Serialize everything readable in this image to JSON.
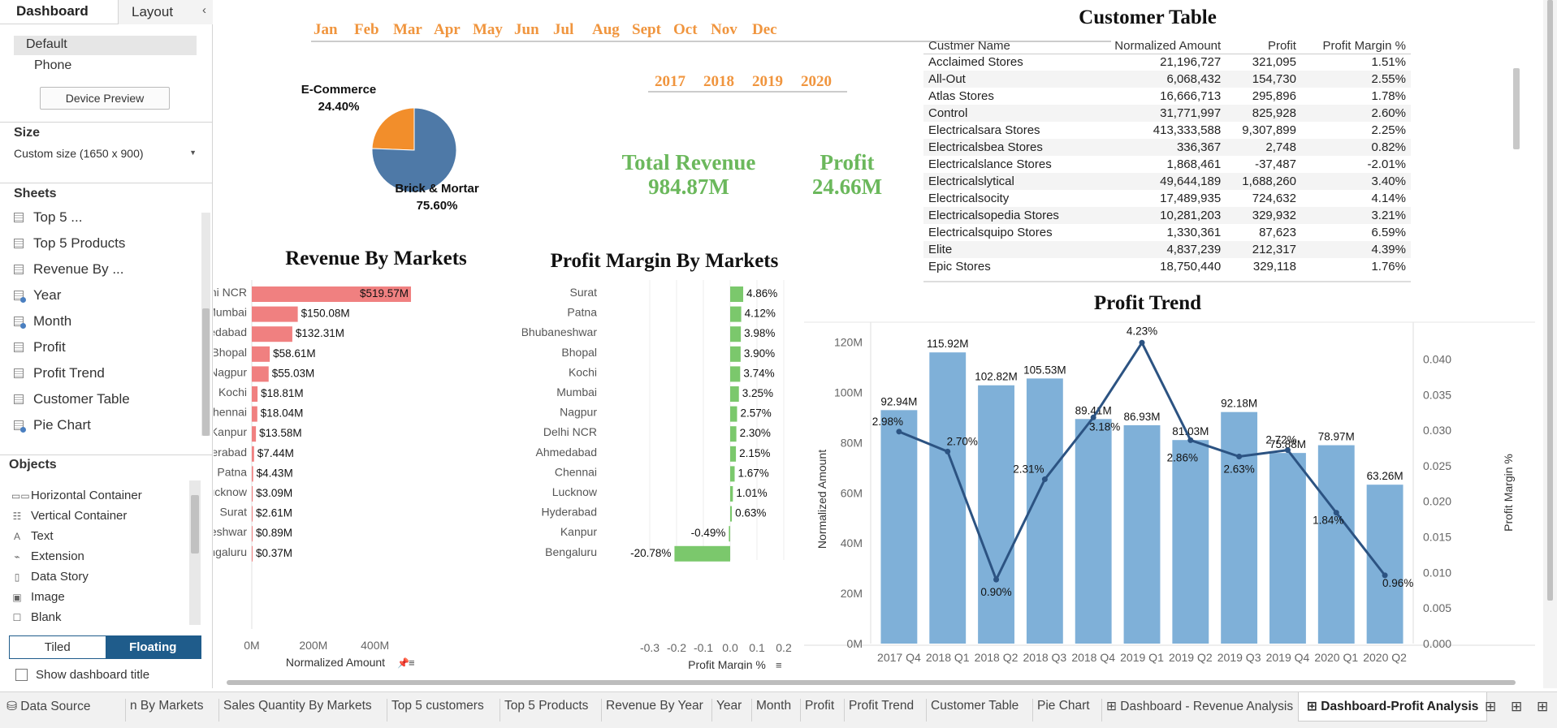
{
  "left_panel": {
    "tab_dashboard": "Dashboard",
    "tab_layout": "Layout",
    "collapse_icon": "chevron-left-icon",
    "device_default": "Default",
    "device_phone": "Phone",
    "device_preview": "Device Preview",
    "size_title": "Size",
    "size_value": "Custom size (1650 x 900)",
    "sheets_title": "Sheets",
    "sheets": [
      {
        "label": "Top 5 ...",
        "icon": "sheet-icon"
      },
      {
        "label": "Top 5 Products",
        "icon": "sheet-icon"
      },
      {
        "label": "Revenue By ...",
        "icon": "sheet-icon"
      },
      {
        "label": "Year",
        "icon": "sheet-globe-icon"
      },
      {
        "label": "Month",
        "icon": "sheet-globe-icon"
      },
      {
        "label": "Profit",
        "icon": "sheet-icon"
      },
      {
        "label": "Profit Trend",
        "icon": "sheet-icon"
      },
      {
        "label": "Customer Table",
        "icon": "sheet-icon"
      },
      {
        "label": "Pie Chart",
        "icon": "sheet-globe-icon"
      }
    ],
    "objects_title": "Objects",
    "objects": [
      {
        "label": "Horizontal Container",
        "icon": "horizontal-container-icon"
      },
      {
        "label": "Vertical Container",
        "icon": "vertical-container-icon"
      },
      {
        "label": "Text",
        "icon": "text-icon"
      },
      {
        "label": "Extension",
        "icon": "extension-icon"
      },
      {
        "label": "Data Story",
        "icon": "data-story-icon"
      },
      {
        "label": "Image",
        "icon": "image-icon"
      },
      {
        "label": "Blank",
        "icon": "blank-icon"
      }
    ],
    "tiled": "Tiled",
    "floating": "Floating",
    "show_title": "Show dashboard title"
  },
  "dashboard": {
    "months": [
      "Jan",
      "Feb",
      "Mar",
      "Apr",
      "May",
      "Jun",
      "Jul",
      "Aug",
      "Sept",
      "Oct",
      "Nov",
      "Dec"
    ],
    "years": [
      "2017",
      "2018",
      "2019",
      "2020"
    ],
    "pie": {
      "slices": [
        {
          "label": "E-Commerce",
          "pct": "24.40%",
          "value": 24.4,
          "color": "#f28e2b"
        },
        {
          "label": "Brick & Mortar",
          "pct": "75.60%",
          "value": 75.6,
          "color": "#4e79a7"
        }
      ]
    },
    "kpis": {
      "revenue_label": "Total Revenue",
      "revenue_value": "984.87M",
      "profit_label": "Profit",
      "profit_value": "24.66M",
      "color": "#6bb85c"
    },
    "customer_table": {
      "title": "Customer Table",
      "columns": [
        "Custmer Name",
        "Normalized Amount",
        "Profit",
        "Profit Margin %"
      ],
      "rows": [
        [
          "Acclaimed Stores",
          "21,196,727",
          "321,095",
          "1.51%"
        ],
        [
          "All-Out",
          "6,068,432",
          "154,730",
          "2.55%"
        ],
        [
          "Atlas Stores",
          "16,666,713",
          "295,896",
          "1.78%"
        ],
        [
          "Control",
          "31,771,997",
          "825,928",
          "2.60%"
        ],
        [
          "Electricalsara Stores",
          "413,333,588",
          "9,307,899",
          "2.25%"
        ],
        [
          "Electricalsbea Stores",
          "336,367",
          "2,748",
          "0.82%"
        ],
        [
          "Electricalslance Stores",
          "1,868,461",
          "-37,487",
          "-2.01%"
        ],
        [
          "Electricalslytical",
          "49,644,189",
          "1,688,260",
          "3.40%"
        ],
        [
          "Electricalsocity",
          "17,489,935",
          "724,632",
          "4.14%"
        ],
        [
          "Electricalsopedia Stores",
          "10,281,203",
          "329,932",
          "3.21%"
        ],
        [
          "Electricalsquipo Stores",
          "1,330,361",
          "87,623",
          "6.59%"
        ],
        [
          "Elite",
          "4,837,239",
          "212,317",
          "4.39%"
        ],
        [
          "Epic Stores",
          "18,750,440",
          "329,118",
          "1.76%"
        ]
      ]
    }
  },
  "chart_data": [
    {
      "type": "pie",
      "title": "",
      "categories": [
        "E-Commerce",
        "Brick & Mortar"
      ],
      "values": [
        24.4,
        75.6
      ],
      "colors": [
        "#f28e2b",
        "#4e79a7"
      ]
    },
    {
      "type": "bar",
      "orientation": "horizontal",
      "title": "Revenue By Markets",
      "xlabel": "Normalized Amount",
      "categories": [
        "Delhi NCR",
        "Mumbai",
        "Ahmedabad",
        "Bhopal",
        "Nagpur",
        "Kochi",
        "Chennai",
        "Kanpur",
        "Hyderabad",
        "Patna",
        "Lucknow",
        "Surat",
        "Bhubaneshwar",
        "Bengaluru"
      ],
      "values": [
        519.57,
        150.08,
        132.31,
        58.61,
        55.03,
        18.81,
        18.04,
        13.58,
        7.44,
        4.43,
        3.09,
        2.61,
        0.89,
        0.37
      ],
      "labels": [
        "$519.57M",
        "$150.08M",
        "$132.31M",
        "$58.61M",
        "$55.03M",
        "$18.81M",
        "$18.04M",
        "$13.58M",
        "$7.44M",
        "$4.43M",
        "$3.09M",
        "$2.61M",
        "$0.89M",
        "$0.37M"
      ],
      "xticks": [
        "0M",
        "200M",
        "400M"
      ],
      "xlim": [
        0,
        530
      ],
      "color": "#f08080"
    },
    {
      "type": "bar",
      "orientation": "horizontal",
      "title": "Profit Margin By Markets",
      "xlabel": "Profit Margin %",
      "categories": [
        "Surat",
        "Patna",
        "Bhubaneshwar",
        "Bhopal",
        "Kochi",
        "Mumbai",
        "Nagpur",
        "Delhi NCR",
        "Ahmedabad",
        "Chennai",
        "Lucknow",
        "Hyderabad",
        "Kanpur",
        "Bengaluru"
      ],
      "values": [
        4.86,
        4.12,
        3.98,
        3.9,
        3.74,
        3.25,
        2.57,
        2.3,
        2.15,
        1.67,
        1.01,
        0.63,
        -0.49,
        -20.78
      ],
      "labels": [
        "4.86%",
        "4.12%",
        "3.98%",
        "3.90%",
        "3.74%",
        "3.25%",
        "2.57%",
        "2.30%",
        "2.15%",
        "1.67%",
        "1.01%",
        "0.63%",
        "-0.49%",
        "-20.78%"
      ],
      "xticks": [
        "-0.3",
        "-0.2",
        "-0.1",
        "0.0",
        "0.1",
        "0.2"
      ],
      "xlim": [
        -0.3,
        0.2
      ],
      "color": "#7bc86c"
    },
    {
      "type": "bar",
      "title": "Profit Trend",
      "ylabel": "Normalized Amount",
      "y2label": "Profit Margin %",
      "categories": [
        "2017 Q4",
        "2018 Q1",
        "2018 Q2",
        "2018 Q3",
        "2018 Q4",
        "2019 Q1",
        "2019 Q2",
        "2019 Q3",
        "2019 Q4",
        "2020 Q1",
        "2020 Q2"
      ],
      "series": [
        {
          "values": [
            92.94,
            115.92,
            102.82,
            105.53,
            89.41,
            86.93,
            81.03,
            92.18,
            75.88,
            78.97,
            63.26
          ],
          "labels": [
            "92.94M",
            "115.92M",
            "102.82M",
            "105.53M",
            "89.41M",
            "86.93M",
            "81.03M",
            "92.18M",
            "75.88M",
            "78.97M",
            "63.26M"
          ],
          "color": "#7fb0d8"
        },
        {
          "type": "line",
          "values": [
            2.98,
            2.7,
            0.9,
            2.31,
            3.18,
            4.23,
            2.86,
            2.63,
            2.72,
            1.84,
            0.96
          ],
          "labels": [
            "2.98%",
            "2.70%",
            "0.90%",
            "2.31%",
            "3.18%",
            "4.23%",
            "2.86%",
            "2.63%",
            "2.72%",
            "1.84%",
            "0.96%"
          ],
          "color": "#2c5382"
        }
      ],
      "yticks": [
        "0M",
        "20M",
        "40M",
        "60M",
        "80M",
        "100M",
        "120M"
      ],
      "ylim": [
        0,
        126
      ],
      "y2ticks": [
        "0.000",
        "0.005",
        "0.010",
        "0.015",
        "0.020",
        "0.025",
        "0.030",
        "0.035",
        "0.040"
      ],
      "y2lim": [
        0,
        0.0445
      ]
    }
  ],
  "bottom_tabs": {
    "items": [
      "Data Source",
      "n By Markets",
      "Sales Quantity By Markets",
      "Top 5 customers",
      "Top 5 Products",
      "Revenue By Year",
      "Year",
      "Month",
      "Profit",
      "Profit Trend",
      "Customer Table",
      "Pie Chart",
      "Dashboard - Revenue Analysis",
      "Dashboard-Profit Analysis"
    ],
    "active": "Dashboard-Profit Analysis"
  }
}
